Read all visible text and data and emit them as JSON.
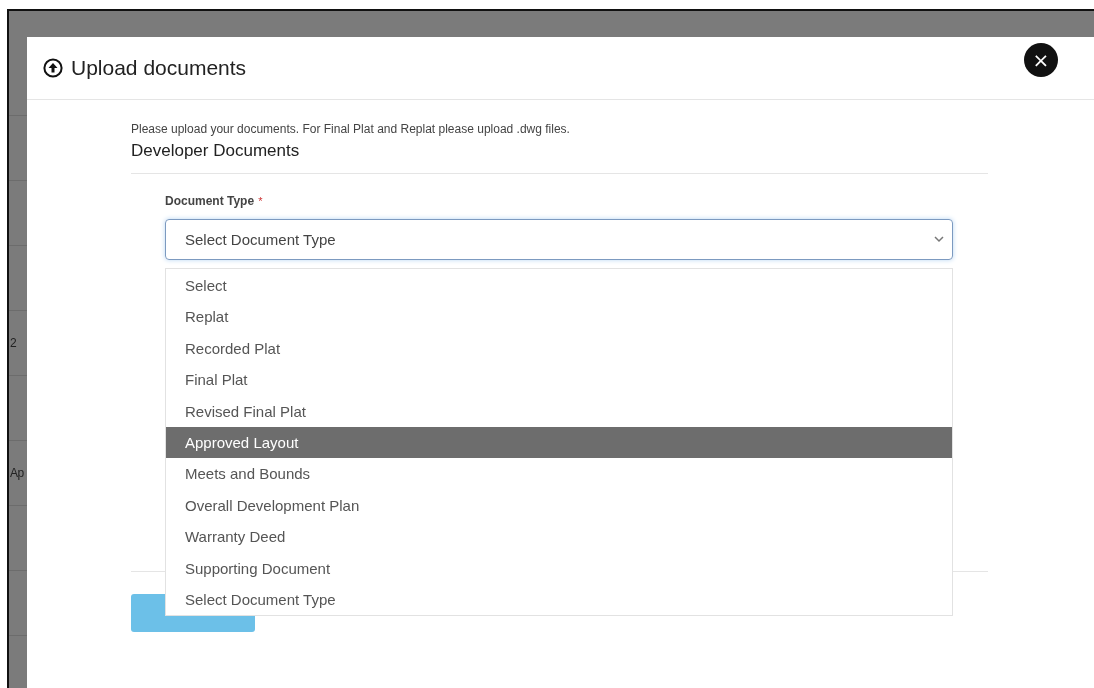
{
  "background": {
    "row_fragments": [
      "2",
      "Ap"
    ]
  },
  "dialog": {
    "title": "Upload documents",
    "close": "×",
    "instructions": "Please upload your documents. For Final Plat and Replat please upload .dwg files.",
    "section_title": "Developer Documents",
    "field": {
      "label": "Document Type",
      "required_mark": "*",
      "value": "Select Document Type",
      "expanded": true
    },
    "options": [
      {
        "label": "Select",
        "selected": false
      },
      {
        "label": "Replat",
        "selected": false
      },
      {
        "label": "Recorded Plat",
        "selected": false
      },
      {
        "label": "Final Plat",
        "selected": false
      },
      {
        "label": "Revised Final Plat",
        "selected": false
      },
      {
        "label": "Approved Layout",
        "selected": true
      },
      {
        "label": "Meets and Bounds",
        "selected": false
      },
      {
        "label": "Overall Development Plan",
        "selected": false
      },
      {
        "label": "Warranty Deed",
        "selected": false
      },
      {
        "label": "Supporting Document",
        "selected": false
      },
      {
        "label": "Select Document Type",
        "selected": false
      }
    ]
  }
}
